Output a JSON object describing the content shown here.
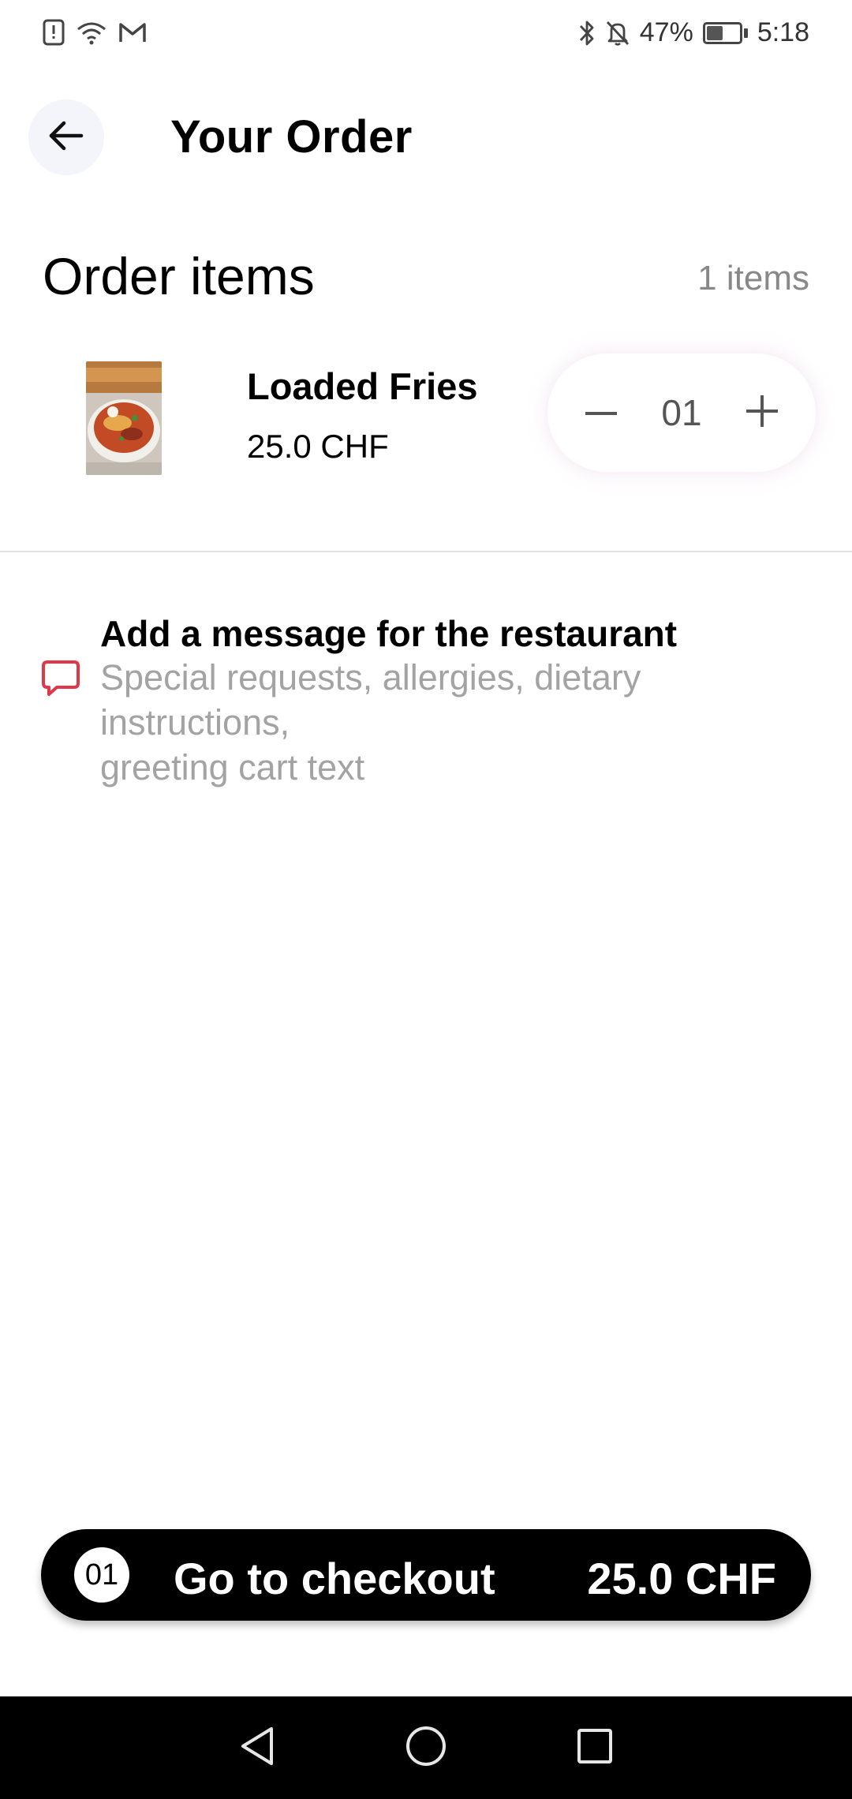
{
  "status_bar": {
    "battery_percent": "47%",
    "battery_level": 0.47,
    "time": "5:18",
    "icons": [
      "alert-icon",
      "wifi-icon",
      "gmail-icon",
      "bluetooth-icon",
      "mute-icon",
      "battery-icon"
    ]
  },
  "header": {
    "title": "Your Order",
    "back_icon": "arrow-left-icon"
  },
  "order": {
    "section_title": "Order items",
    "count_label": "1 items",
    "items": [
      {
        "name": "Loaded Fries",
        "price": "25.0 CHF",
        "quantity": "01",
        "image": "loaded-fries-photo"
      }
    ]
  },
  "message": {
    "title": "Add a message for the restaurant",
    "subtitle_line1": "Special requests, allergies, dietary",
    "subtitle_line2": "instructions,",
    "subtitle_line3": "greeting cart text",
    "icon": "chat-bubble-icon",
    "icon_color": "#e0384b"
  },
  "checkout": {
    "count": "01",
    "label": "Go to checkout",
    "total": "25.0 CHF"
  },
  "nav_bar": {
    "icons": [
      "back-triangle-icon",
      "home-circle-icon",
      "recents-square-icon"
    ]
  }
}
